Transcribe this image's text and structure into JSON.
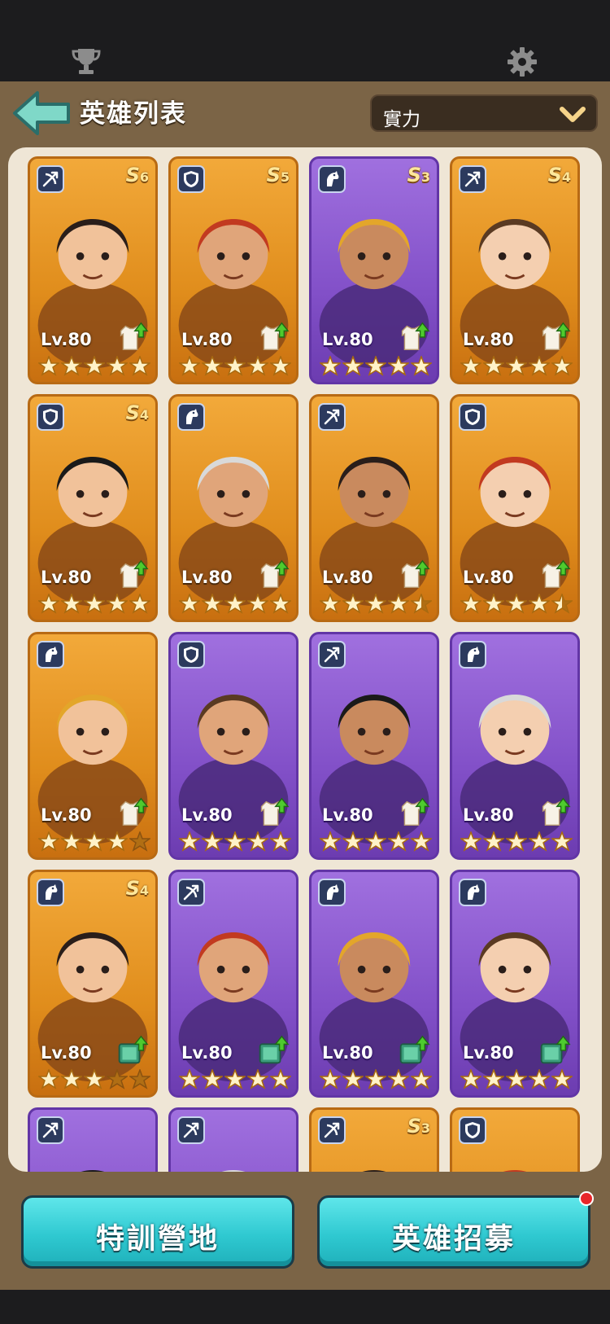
{
  "header": {
    "title": "英雄列表",
    "sort_value": "實力",
    "icons": [
      "trophy-icon",
      "gear-icon",
      "back-arrow-icon",
      "chevron-down-icon"
    ]
  },
  "heroes": [
    {
      "level_text": "Lv.80",
      "rank_letter": "S",
      "rank_num": "6",
      "class": "archer",
      "frame": "gold",
      "stars_filled": 5,
      "upgrade": "shirt"
    },
    {
      "level_text": "Lv.80",
      "rank_letter": "S",
      "rank_num": "5",
      "class": "shield",
      "frame": "gold",
      "stars_filled": 5,
      "upgrade": "shirt"
    },
    {
      "level_text": "Lv.80",
      "rank_letter": "S",
      "rank_num": "3",
      "class": "cavalry",
      "frame": "purple",
      "stars_filled": 5,
      "upgrade": "shirt"
    },
    {
      "level_text": "Lv.80",
      "rank_letter": "S",
      "rank_num": "4",
      "class": "archer",
      "frame": "gold",
      "stars_filled": 5,
      "upgrade": "shirt"
    },
    {
      "level_text": "Lv.80",
      "rank_letter": "S",
      "rank_num": "4",
      "class": "shield",
      "frame": "gold",
      "stars_filled": 5,
      "upgrade": "shirt"
    },
    {
      "level_text": "Lv.80",
      "rank_letter": "",
      "rank_num": "",
      "class": "cavalry",
      "frame": "gold",
      "stars_filled": 5,
      "upgrade": "shirt"
    },
    {
      "level_text": "Lv.80",
      "rank_letter": "",
      "rank_num": "",
      "class": "archer",
      "frame": "gold",
      "stars_filled": 4.5,
      "upgrade": "shirt"
    },
    {
      "level_text": "Lv.80",
      "rank_letter": "",
      "rank_num": "",
      "class": "shield",
      "frame": "gold",
      "stars_filled": 4.5,
      "upgrade": "shirt"
    },
    {
      "level_text": "Lv.80",
      "rank_letter": "",
      "rank_num": "",
      "class": "cavalry",
      "frame": "gold",
      "stars_filled": 4,
      "upgrade": "shirt"
    },
    {
      "level_text": "Lv.80",
      "rank_letter": "",
      "rank_num": "",
      "class": "shield",
      "frame": "purple",
      "stars_filled": 5,
      "upgrade": "shirt"
    },
    {
      "level_text": "Lv.80",
      "rank_letter": "",
      "rank_num": "",
      "class": "archer",
      "frame": "purple",
      "stars_filled": 5,
      "upgrade": "shirt"
    },
    {
      "level_text": "Lv.80",
      "rank_letter": "",
      "rank_num": "",
      "class": "cavalry",
      "frame": "purple",
      "stars_filled": 5,
      "upgrade": "shirt"
    },
    {
      "level_text": "Lv.80",
      "rank_letter": "S",
      "rank_num": "4",
      "class": "cavalry",
      "frame": "gold",
      "stars_filled": 3,
      "upgrade": "book"
    },
    {
      "level_text": "Lv.80",
      "rank_letter": "",
      "rank_num": "",
      "class": "archer",
      "frame": "purple",
      "stars_filled": 5,
      "upgrade": "book"
    },
    {
      "level_text": "Lv.80",
      "rank_letter": "",
      "rank_num": "",
      "class": "cavalry",
      "frame": "purple",
      "stars_filled": 5,
      "upgrade": "book"
    },
    {
      "level_text": "Lv.80",
      "rank_letter": "",
      "rank_num": "",
      "class": "cavalry",
      "frame": "purple",
      "stars_filled": 5,
      "upgrade": "book"
    },
    {
      "level_text": "",
      "rank_letter": "",
      "rank_num": "",
      "class": "archer",
      "frame": "purple",
      "stars_filled": 0,
      "upgrade": ""
    },
    {
      "level_text": "",
      "rank_letter": "",
      "rank_num": "",
      "class": "archer",
      "frame": "purple",
      "stars_filled": 0,
      "upgrade": ""
    },
    {
      "level_text": "",
      "rank_letter": "S",
      "rank_num": "3",
      "class": "archer",
      "frame": "gold",
      "stars_filled": 0,
      "upgrade": ""
    },
    {
      "level_text": "",
      "rank_letter": "",
      "rank_num": "",
      "class": "shield",
      "frame": "gold",
      "stars_filled": 0,
      "upgrade": ""
    }
  ],
  "buttons": {
    "training_camp": "特訓營地",
    "recruit": "英雄招募"
  },
  "colors": {
    "gold_frame": "#e08d1c",
    "purple_frame": "#8250c8",
    "button": "#2fc9d1",
    "notification": "#e8262a"
  }
}
